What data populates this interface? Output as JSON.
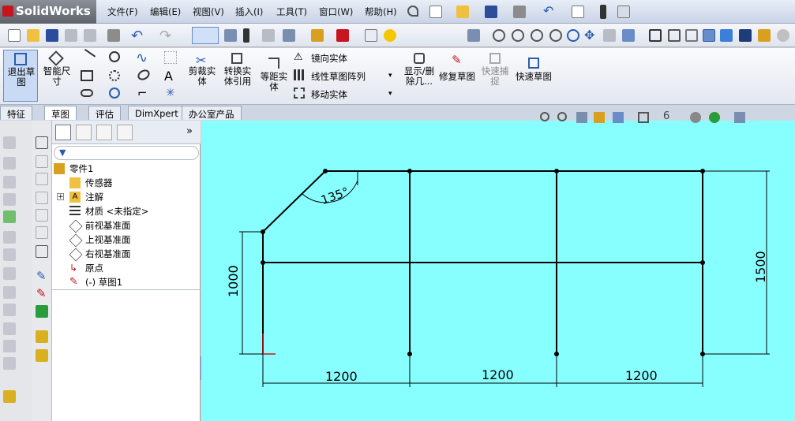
{
  "app": {
    "logo": "SolidWorks"
  },
  "menu": [
    "文件(F)",
    "编辑(E)",
    "视图(V)",
    "插入(I)",
    "工具(T)",
    "窗口(W)",
    "帮助(H)"
  ],
  "command_manager": {
    "exit_sketch": "退出草图",
    "smart_dim": "智能尺寸",
    "trim": "剪裁实体",
    "convert": "转换实体引用",
    "offset": "等距实体",
    "mirror": "镜向实体",
    "linear_pattern": "线性草图阵列",
    "move": "移动实体",
    "display_delete": "显示/删除几...",
    "repair": "修复草图",
    "quick_snap": "快速捕捉",
    "rapid_sketch": "快速草图"
  },
  "tabs": [
    "特征",
    "草图",
    "评估",
    "DimXpert",
    "办公室产品"
  ],
  "tree": {
    "filter_placeholder": "",
    "items": [
      {
        "label": "零件1",
        "icon": "part-icon"
      },
      {
        "label": "传感器",
        "icon": "sensor-icon"
      },
      {
        "label": "注解",
        "icon": "annotation-icon"
      },
      {
        "label": "材质 <未指定>",
        "icon": "material-icon"
      },
      {
        "label": "前视基准面",
        "icon": "plane-icon"
      },
      {
        "label": "上视基准面",
        "icon": "plane-icon"
      },
      {
        "label": "右视基准面",
        "icon": "plane-icon"
      },
      {
        "label": "原点",
        "icon": "origin-icon"
      },
      {
        "label": "(-) 草图1",
        "icon": "sketch-icon"
      }
    ]
  },
  "sketch": {
    "angle": "135°",
    "dims": {
      "height_left": "1000",
      "height_right": "1500",
      "w1": "1200",
      "w2": "1200",
      "w3": "1200"
    }
  },
  "colors": {
    "canvas": "#88ffff",
    "accent": "#2a5db0"
  }
}
